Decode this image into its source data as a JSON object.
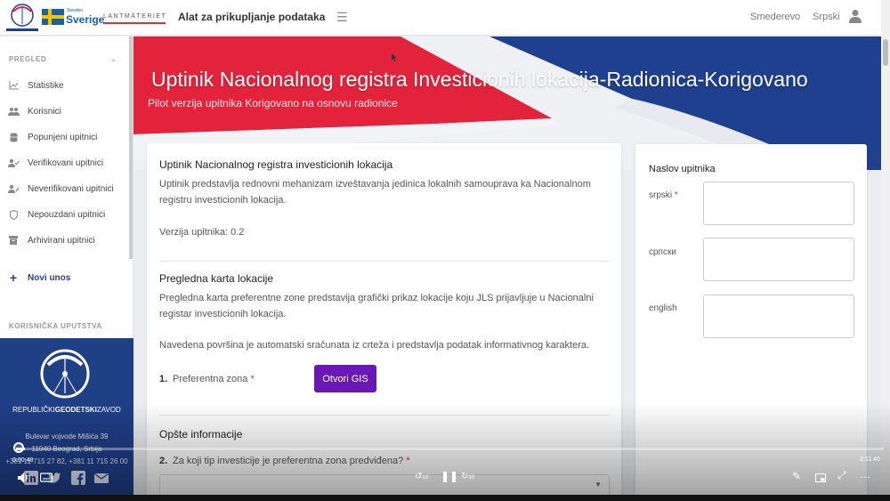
{
  "header": {
    "sverige_small": "Sweden",
    "sverige_big": "Sverige",
    "lantmateriet": "LANTMÄTERIET",
    "app_title": "Alat za prikupljanje podataka",
    "location": "Smederevo",
    "language": "Srpski"
  },
  "sidebar": {
    "section_pregled": "PREGLED",
    "items": [
      {
        "label": "Statistike",
        "icon": "chart-line-icon"
      },
      {
        "label": "Korisnici",
        "icon": "users-icon"
      },
      {
        "label": "Popunjeni upitnici",
        "icon": "database-icon"
      },
      {
        "label": "Verifikovani upitnici",
        "icon": "user-check-icon"
      },
      {
        "label": "Neverifikovani upitnici",
        "icon": "user-edit-icon"
      },
      {
        "label": "Nepouzdani upitnici",
        "icon": "shield-icon"
      },
      {
        "label": "Arhivirani upitnici",
        "icon": "archive-icon"
      }
    ],
    "new_entry": "Novi unos",
    "section_guide": "KORISNIČKA UPUTSTVA",
    "org_name_1": "REPUBLIČKI",
    "org_name_2": "GEODETSKI",
    "org_name_3": "ZAVOD",
    "address_1": "Bulevar vojvode Mišića 39",
    "address_2": "11040 Beograd, Srbija",
    "phone": "+381 11 715 27 82, +381 11 715 26 00"
  },
  "hero": {
    "title": "Uptinik Nacionalnog registra Investicionih lokacija-Radionica-Korigovano",
    "subtitle": "Pilot verzija upitnika Korigovano na osnovu radionice",
    "colors": {
      "red": "#e3233b",
      "blue": "#1f3f8f"
    }
  },
  "main": {
    "section1_title": "Uptinik Nacionalnog registra investicionih lokacija",
    "section1_desc_1": "Uptinik predstavlja rednovni mehanizam izveštavanja jedinica lokalnih samouprava ka Nacionalnom",
    "section1_desc_2": "registru investicionih lokacija.",
    "version": "Verzija upitnika: 0.2",
    "section2_title": "Pregledna karta lokacije",
    "section2_desc_1": "Pregledna karta preferentne zone predstavija grafički prikaz lokacije koju JLS prijavljuje u Nacionalni",
    "section2_desc_2": "registar investicionih lokacija.",
    "section2_note": "Navedena površina je automatski sračunata iz crteža i predstavlja podatak informativnog karaktera.",
    "q1_num": "1.",
    "q1_label": "Preferentna zona",
    "q1_required": "*",
    "gis_button": "Otvori GIS",
    "section3_title": "Opšte informacije",
    "q2_num": "2.",
    "q2_label": "Za koji tip investicije je preferentna zona predviđena?",
    "q2_required": "*",
    "accent": "#6a17b8"
  },
  "title_panel": {
    "heading": "Naslov upitnika",
    "fields": [
      {
        "label": "srpski",
        "required": "*"
      },
      {
        "label": "српски",
        "required": ""
      },
      {
        "label": "english",
        "required": ""
      }
    ]
  },
  "player": {
    "current_time": "0:00:48",
    "total_time": "2:11:40",
    "progress": 0.01,
    "rewind_label": "10",
    "forward_label": "30"
  }
}
